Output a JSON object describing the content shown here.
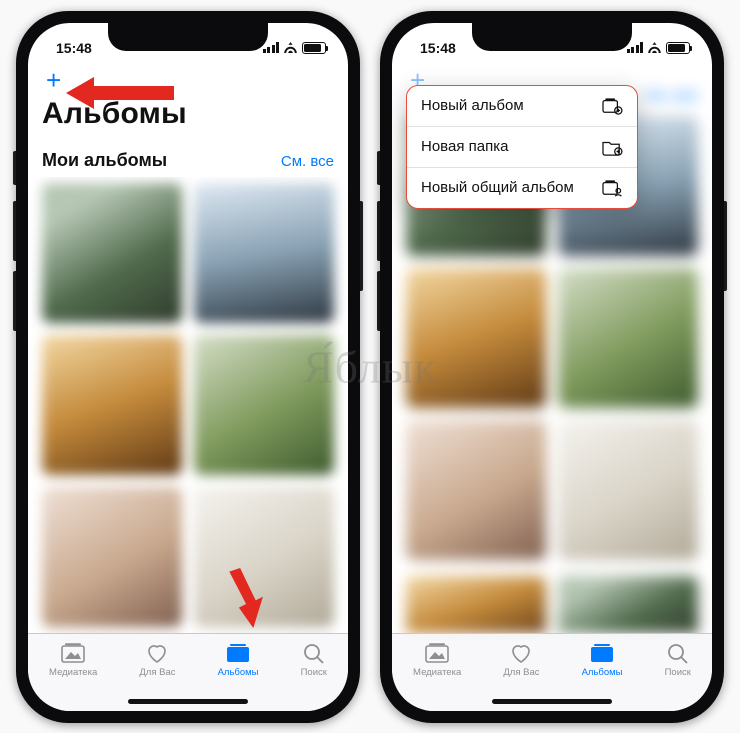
{
  "status": {
    "time": "15:48"
  },
  "header": {
    "plus": "+",
    "title": "Альбомы"
  },
  "section": {
    "title": "Мои альбомы",
    "see_all": "См. все"
  },
  "tabs": {
    "library": "Медиатека",
    "for_you": "Для Вас",
    "albums": "Альбомы",
    "search": "Поиск"
  },
  "menu": {
    "new_album": "Новый альбом",
    "new_folder": "Новая папка",
    "new_shared_album": "Новый общий альбом"
  },
  "watermark": "Я́блык"
}
